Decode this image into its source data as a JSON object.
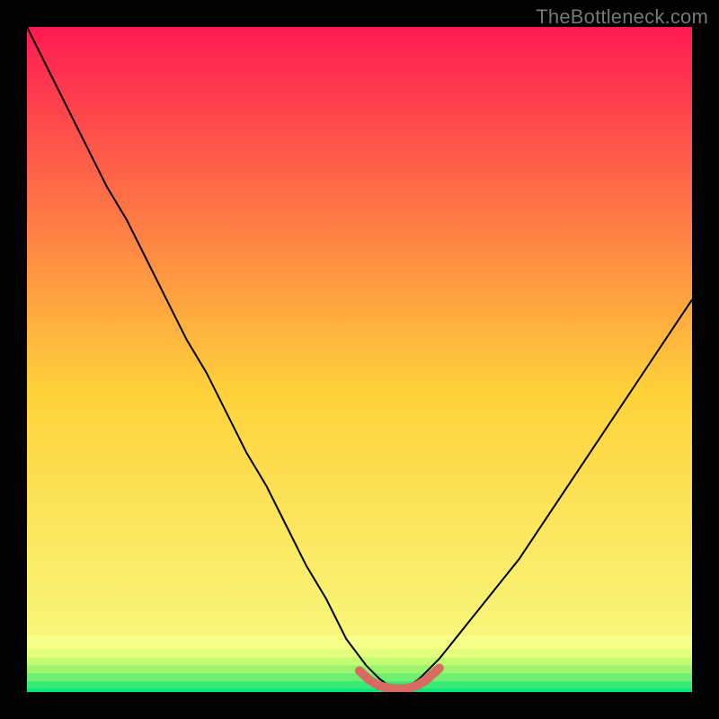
{
  "watermark": "TheBottleneck.com",
  "chart_data": {
    "type": "line",
    "title": "",
    "xlabel": "",
    "ylabel": "",
    "xlim": [
      0,
      100
    ],
    "ylim": [
      0,
      100
    ],
    "grid": false,
    "legend": false,
    "background_gradient": {
      "top_color": "#ff1a52",
      "mid_color": "#ffd23a",
      "bottom_color": "#00e879"
    },
    "series": [
      {
        "name": "bottleneck-curve",
        "color": "#000000",
        "stroke_width": 2,
        "x": [
          0,
          3,
          6,
          9,
          12,
          15,
          18,
          21,
          24,
          27,
          30,
          33,
          36,
          39,
          42,
          45,
          48,
          51,
          53,
          55,
          57,
          59,
          62,
          66,
          70,
          74,
          78,
          82,
          86,
          90,
          94,
          98,
          100
        ],
        "values": [
          100,
          94,
          88,
          82,
          76,
          71,
          65,
          59,
          53,
          48,
          42,
          36,
          31,
          25,
          19,
          14,
          8,
          4,
          2,
          0.5,
          0.5,
          2,
          5,
          10,
          15,
          20,
          26,
          32,
          38,
          44,
          50,
          56,
          59
        ]
      },
      {
        "name": "bottom-highlight",
        "color": "#d86a62",
        "stroke_width": 10,
        "linecap": "round",
        "x": [
          50,
          51.5,
          53,
          55,
          57,
          58.5,
          60,
          62
        ],
        "values": [
          3.2,
          1.8,
          0.9,
          0.5,
          0.5,
          0.9,
          1.8,
          3.6
        ]
      }
    ],
    "bottom_bands": [
      {
        "color": "#f7ff8a",
        "y_from": 8.5,
        "y_to": 6.5
      },
      {
        "color": "#e3ff7d",
        "y_from": 6.5,
        "y_to": 5.2
      },
      {
        "color": "#c3fb72",
        "y_from": 5.2,
        "y_to": 4.0
      },
      {
        "color": "#9cf46e",
        "y_from": 4.0,
        "y_to": 2.8
      },
      {
        "color": "#6fef70",
        "y_from": 2.8,
        "y_to": 1.6
      },
      {
        "color": "#36ea75",
        "y_from": 1.6,
        "y_to": 0.5
      },
      {
        "color": "#00e879",
        "y_from": 0.5,
        "y_to": 0.0
      }
    ]
  }
}
